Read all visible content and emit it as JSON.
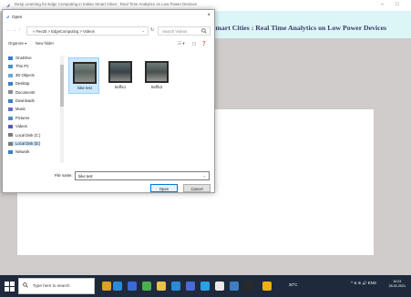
{
  "app": {
    "title": "Deep Learning for Edge Computing in Indian Smart Cities : Real Time Analytics on Low Power Devices",
    "heading": "Smart Cities : Real Time Analytics on Low Power Devices",
    "minimize": "–",
    "maximize": "□"
  },
  "dialog": {
    "title": "Open",
    "close": "×",
    "address": "«  Fee25  >  EdgeComputing  >  Videos",
    "search_placeholder": "Search Videos",
    "toolbar": {
      "organize": "Organize ▾",
      "new_folder": "New folder"
    },
    "nav_items": [
      {
        "label": "OneDrive",
        "color": "#3a7bd5"
      },
      {
        "label": "This PC",
        "color": "#4a90c8"
      },
      {
        "label": "3D Objects",
        "color": "#6aa6d9"
      },
      {
        "label": "Desktop",
        "color": "#3e7fc4"
      },
      {
        "label": "Documents",
        "color": "#8c8c8c"
      },
      {
        "label": "Downloads",
        "color": "#3e7fc4"
      },
      {
        "label": "Music",
        "color": "#6b6bd0"
      },
      {
        "label": "Pictures",
        "color": "#4a90c8"
      },
      {
        "label": "Videos",
        "color": "#5a5ab8"
      },
      {
        "label": "Local Disk (C:)",
        "color": "#7a7a7a"
      },
      {
        "label": "Local Disk (D:)",
        "color": "#7a7a7a"
      },
      {
        "label": "Network",
        "color": "#3e7fc4"
      }
    ],
    "files": [
      {
        "name": "bike test"
      },
      {
        "name": "traffic1"
      },
      {
        "name": "traffic2"
      }
    ],
    "filename_label": "File name:",
    "filename_value": "bike test",
    "open_label": "Open",
    "cancel_label": "Cancel"
  },
  "taskbar": {
    "search_placeholder": "Type here to search",
    "weather": "30°C",
    "tray_status": "^ ⊕ ⊕ 🔊 ENG",
    "time": "10:23",
    "date": "28-02-2021",
    "icons": [
      {
        "name": "task-view-icon",
        "color": "#e0a020"
      },
      {
        "name": "edge-icon",
        "color": "#2a8bd6"
      },
      {
        "name": "store-icon",
        "color": "#3a6ad6"
      },
      {
        "name": "chrome-icon",
        "color": "#4ab04a"
      },
      {
        "name": "explorer-icon",
        "color": "#e8c04a"
      },
      {
        "name": "photos-icon",
        "color": "#2a8bd6"
      },
      {
        "name": "settings-icon",
        "color": "#4a6ad6"
      },
      {
        "name": "app-icon-a",
        "color": "#2aa0e6"
      },
      {
        "name": "app-icon-b",
        "color": "#e8e8e8"
      },
      {
        "name": "app-icon-c",
        "color": "#3e7fc4"
      },
      {
        "name": "app-icon-d",
        "color": "#2a2a2a"
      },
      {
        "name": "app-icon-e",
        "color": "#f2b010"
      }
    ]
  }
}
